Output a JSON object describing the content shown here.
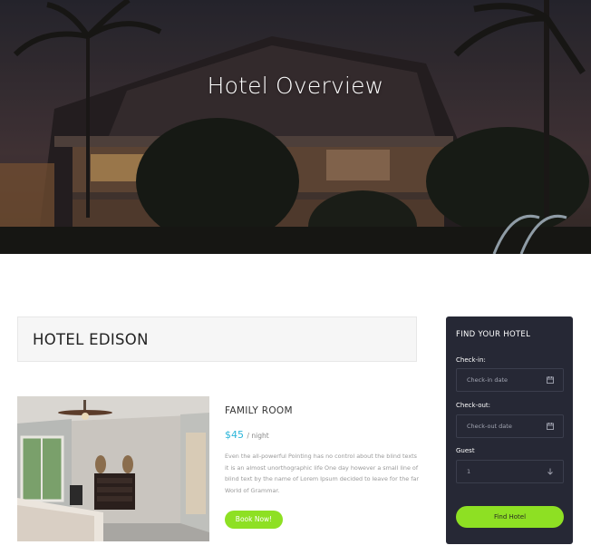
{
  "hero": {
    "title": "Hotel Overview"
  },
  "hotel": {
    "name": "HOTEL EDISON"
  },
  "room": {
    "title": "FAMILY ROOM",
    "price": "$45",
    "per_night": "/ night",
    "description": "Even the all-powerful Pointing has no control about the blind texts it is an almost unorthographic life One day however a small line of blind text by the name of Lorem Ipsum decided to leave for the far World of Grammar.",
    "book_label": "Book Now!"
  },
  "finder": {
    "title": "FIND YOUR HOTEL",
    "checkin_label": "Check-in:",
    "checkin_placeholder": "Check-in date",
    "checkout_label": "Check-out:",
    "checkout_placeholder": "Check-out date",
    "guest_label": "Guest",
    "guest_value": "1",
    "button_label": "Find Hotel"
  },
  "colors": {
    "accent_green": "#8ee023",
    "price_blue": "#2bb5d9",
    "panel_dark": "#262835"
  },
  "icons": [
    "calendar-icon",
    "chevron-down-icon"
  ]
}
